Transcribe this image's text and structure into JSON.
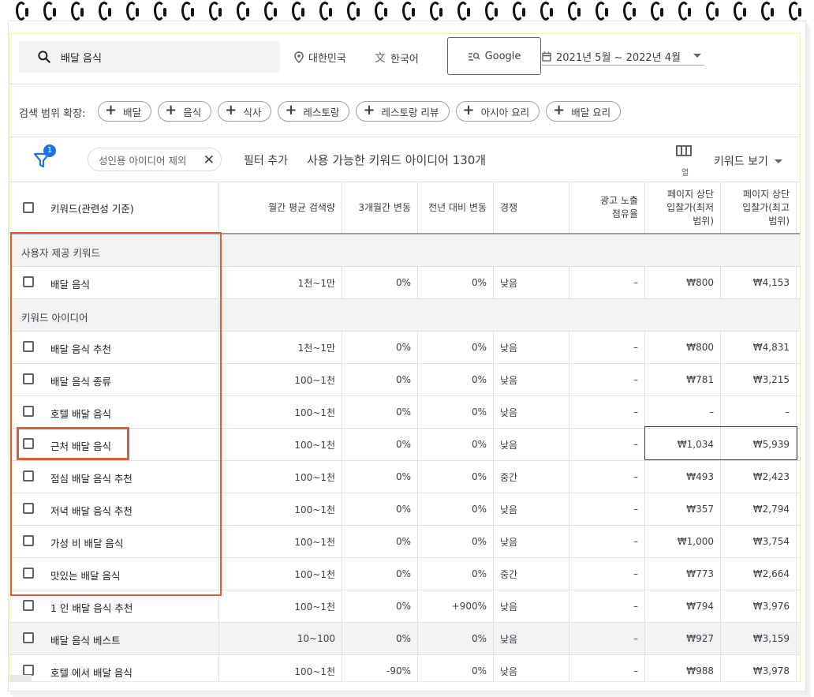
{
  "search": {
    "query": "배달 음식"
  },
  "location": {
    "label": "대한민국",
    "icon": "location-pin-icon"
  },
  "language": {
    "label": "한국어",
    "icon": "translate-icon"
  },
  "engine": {
    "label": "Google"
  },
  "date_range": {
    "label": "2021년 5월 ~ 2022년 4월"
  },
  "expand": {
    "label": "검색 범위 확장:",
    "chips": [
      "배달",
      "음식",
      "식사",
      "레스토랑",
      "레스토랑 리뷰",
      "아시아 요리",
      "배달 요리"
    ]
  },
  "filters": {
    "badge": "1",
    "active_filter": "성인용 아이디어 제외",
    "add_filter": "필터 추가",
    "idea_count": "사용 가능한 키워드 아이디어 130개",
    "columns_label": "열",
    "view_label": "키워드 보기"
  },
  "table": {
    "headers": {
      "keyword": "키워드(관련성 기준)",
      "volume": "월간 평균 검색량",
      "change_3m": "3개월간 변동",
      "change_yoy": "전년 대비 변동",
      "competition": "경쟁",
      "impression_share": [
        "광고 노출",
        "점유율"
      ],
      "bid_low": [
        "페이지 상단",
        "입찰가(최저",
        "범위)"
      ],
      "bid_high": [
        "페이지 상단",
        "입찰가(최고",
        "범위)"
      ]
    },
    "section_user": "사용자 제공 키워드",
    "user_rows": [
      {
        "keyword": "배달 음식",
        "volume": "1천~1만",
        "change_3m": "0%",
        "change_yoy": "0%",
        "competition": "낮음",
        "impression_share": "–",
        "bid_low": "₩800",
        "bid_high": "₩4,153"
      }
    ],
    "section_ideas": "키워드 아이디어",
    "idea_rows": [
      {
        "keyword": "배달 음식 추천",
        "volume": "1천~1만",
        "change_3m": "0%",
        "change_yoy": "0%",
        "competition": "낮음",
        "impression_share": "–",
        "bid_low": "₩800",
        "bid_high": "₩4,831"
      },
      {
        "keyword": "배달 음식 종류",
        "volume": "100~1천",
        "change_3m": "0%",
        "change_yoy": "0%",
        "competition": "낮음",
        "impression_share": "–",
        "bid_low": "₩781",
        "bid_high": "₩3,215"
      },
      {
        "keyword": "호텔 배달 음식",
        "volume": "100~1천",
        "change_3m": "0%",
        "change_yoy": "0%",
        "competition": "낮음",
        "impression_share": "–",
        "bid_low": "–",
        "bid_high": "–"
      },
      {
        "keyword": "근처 배달 음식",
        "volume": "100~1천",
        "change_3m": "0%",
        "change_yoy": "0%",
        "competition": "낮음",
        "impression_share": "–",
        "bid_low": "₩1,034",
        "bid_high": "₩5,939"
      },
      {
        "keyword": "점심 배달 음식 추천",
        "volume": "100~1천",
        "change_3m": "0%",
        "change_yoy": "0%",
        "competition": "중간",
        "impression_share": "–",
        "bid_low": "₩493",
        "bid_high": "₩2,423"
      },
      {
        "keyword": "저녁 배달 음식 추천",
        "volume": "100~1천",
        "change_3m": "0%",
        "change_yoy": "0%",
        "competition": "낮음",
        "impression_share": "–",
        "bid_low": "₩357",
        "bid_high": "₩2,794"
      },
      {
        "keyword": "가성 비 배달 음식",
        "volume": "100~1천",
        "change_3m": "0%",
        "change_yoy": "0%",
        "competition": "낮음",
        "impression_share": "–",
        "bid_low": "₩1,000",
        "bid_high": "₩3,754"
      },
      {
        "keyword": "맛있는 배달 음식",
        "volume": "100~1천",
        "change_3m": "0%",
        "change_yoy": "0%",
        "competition": "중간",
        "impression_share": "–",
        "bid_low": "₩773",
        "bid_high": "₩2,664"
      },
      {
        "keyword": "1 인 배달 음식 추천",
        "volume": "100~1천",
        "change_3m": "0%",
        "change_yoy": "+900%",
        "competition": "낮음",
        "impression_share": "–",
        "bid_low": "₩794",
        "bid_high": "₩3,976"
      },
      {
        "keyword": "배달 음식 베스트",
        "volume": "10~100",
        "change_3m": "0%",
        "change_yoy": "0%",
        "competition": "낮음",
        "impression_share": "–",
        "bid_low": "₩927",
        "bid_high": "₩3,159"
      },
      {
        "keyword": "호텔 에서 배달 음식",
        "volume": "100~1천",
        "change_3m": "-90%",
        "change_yoy": "0%",
        "competition": "낮음",
        "impression_share": "–",
        "bid_low": "₩988",
        "bid_high": "₩3,978"
      }
    ]
  }
}
